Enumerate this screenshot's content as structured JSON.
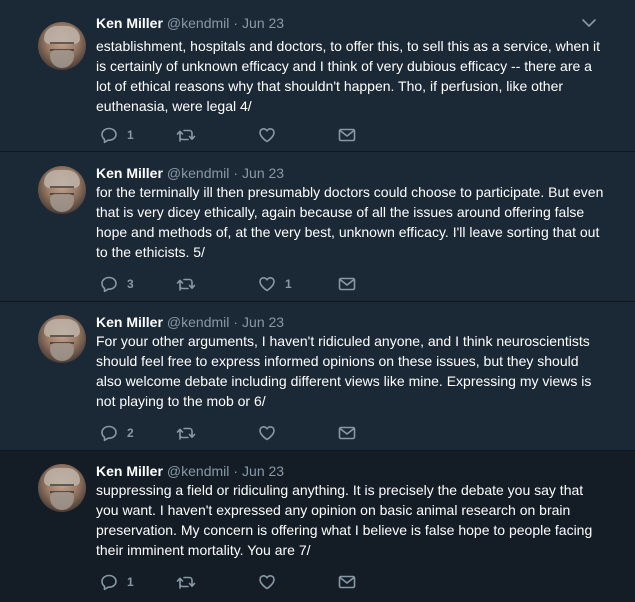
{
  "colors": {
    "background": "#1b2836",
    "highlighted_background": "#141d26",
    "text": "#ffffff",
    "secondary": "#8899a6"
  },
  "tweets": [
    {
      "name": "Ken Miller",
      "handle": "@kendmil",
      "separator": "·",
      "date": "Jun 23",
      "text": "establishment, hospitals and doctors, to offer this, to sell this as a service, when it is certainly of unknown efficacy and I think of very dubious efficacy -- there are a lot of ethical reasons why that shouldn't happen. Tho, if perfusion, like other euthenasia, were legal 4/",
      "reply_count": "1",
      "retweet_count": "",
      "like_count": ""
    },
    {
      "name": "Ken Miller",
      "handle": "@kendmil",
      "separator": "·",
      "date": "Jun 23",
      "text": "for the terminally ill then presumably doctors could choose to participate. But even that is very dicey ethically, again because of all the issues around offering false hope and methods of, at the very best, unknown efficacy. I'll leave sorting that out to the ethicists. 5/",
      "reply_count": "3",
      "retweet_count": "",
      "like_count": "1"
    },
    {
      "name": "Ken Miller",
      "handle": "@kendmil",
      "separator": "·",
      "date": "Jun 23",
      "text": "For your other arguments, I haven't ridiculed anyone, and I think neuroscientists should feel free to express informed opinions on these issues, but they should also welcome debate including different views like mine. Expressing my views is not playing to the mob or 6/",
      "reply_count": "2",
      "retweet_count": "",
      "like_count": ""
    },
    {
      "name": "Ken Miller",
      "handle": "@kendmil",
      "separator": "·",
      "date": "Jun 23",
      "text": "suppressing a field or ridiculing anything. It is precisely the debate you say that you want. I haven't expressed any opinion on basic animal research on brain preservation. My concern is offering what I believe is false hope to people facing their imminent mortality. You are 7/",
      "reply_count": "1",
      "retweet_count": "",
      "like_count": ""
    }
  ]
}
